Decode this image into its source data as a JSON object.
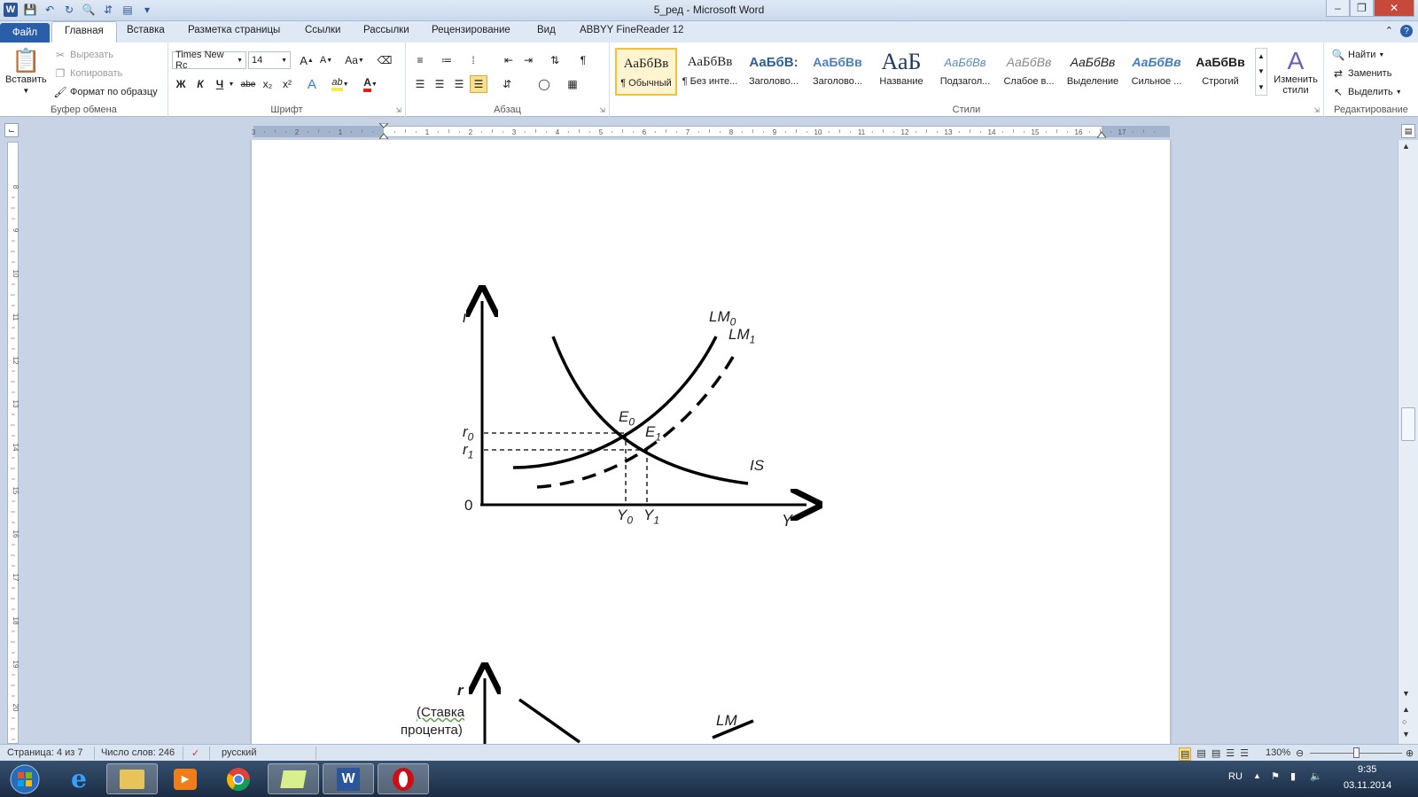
{
  "window": {
    "title": "5_ред - Microsoft Word",
    "app_logo": "W"
  },
  "quick_access": {
    "icons": [
      "save-icon",
      "undo-icon",
      "redo-icon",
      "print-preview-icon",
      "line-spacing-icon",
      "customize-icon"
    ]
  },
  "tabs": {
    "file": "Файл",
    "items": [
      "Главная",
      "Вставка",
      "Разметка страницы",
      "Ссылки",
      "Рассылки",
      "Рецензирование",
      "Вид",
      "ABBYY FineReader 12"
    ],
    "active": "Главная"
  },
  "ribbon": {
    "clipboard": {
      "paste": "Вставить",
      "cut": "Вырезать",
      "copy": "Копировать",
      "format_painter": "Формат по образцу",
      "label": "Буфер обмена"
    },
    "font": {
      "family": "Times New Rc",
      "size": "14",
      "label": "Шрифт",
      "bold": "Ж",
      "italic": "К",
      "underline": "Ч",
      "strike": "abe",
      "subscript": "x₂",
      "superscript": "x²",
      "grow": "A",
      "shrink": "A",
      "case": "Aa"
    },
    "paragraph": {
      "label": "Абзац"
    },
    "styles": {
      "label": "Стили",
      "items": [
        {
          "sample": "АаБбВв",
          "name": "¶ Обычный"
        },
        {
          "sample": "АаБбВв",
          "name": "¶ Без инте..."
        },
        {
          "sample": "АаБбВ:",
          "name": "Заголово..."
        },
        {
          "sample": "АаБбВв",
          "name": "Заголово..."
        },
        {
          "sample": "АаБ",
          "name": "Название"
        },
        {
          "sample": "АаБбВв",
          "name": "Подзагол..."
        },
        {
          "sample": "АаБбВв",
          "name": "Слабое в..."
        },
        {
          "sample": "АаБбВв",
          "name": "Выделение"
        },
        {
          "sample": "АаБбВв",
          "name": "Сильное ..."
        },
        {
          "sample": "АаБбВв",
          "name": "Строгий"
        }
      ],
      "change": "Изменить стили"
    },
    "editing": {
      "label": "Редактирование",
      "find": "Найти",
      "replace": "Заменить",
      "select": "Выделить"
    }
  },
  "figure1": {
    "r_axis": "r",
    "y_axis": "Y",
    "origin": "0",
    "lm0": "LM",
    "lm0_sub": "0",
    "lm1": "LM",
    "lm1_sub": "1",
    "is": "IS",
    "e0": "E",
    "e0_sub": "0",
    "e1": "E",
    "e1_sub": "1",
    "r0": "r",
    "r0_sub": "0",
    "r1": "r",
    "r1_sub": "1",
    "y0": "Y",
    "y0_sub": "0",
    "y1": "Y",
    "y1_sub": "1"
  },
  "figure2": {
    "r_axis": "r",
    "r_caption1": "(Ставка",
    "r_caption2": "процента)",
    "lm": "LM"
  },
  "status": {
    "page": "Страница: 4 из 7",
    "words": "Число слов: 246",
    "language": "русский",
    "zoom": "130%"
  },
  "taskbar": {
    "lang": "RU",
    "time": "9:35",
    "date": "03.11.2014"
  },
  "colors": {
    "accent": "#2b579a",
    "file_tab": "#2a5ea8",
    "selected_style": "#fef4d0"
  }
}
